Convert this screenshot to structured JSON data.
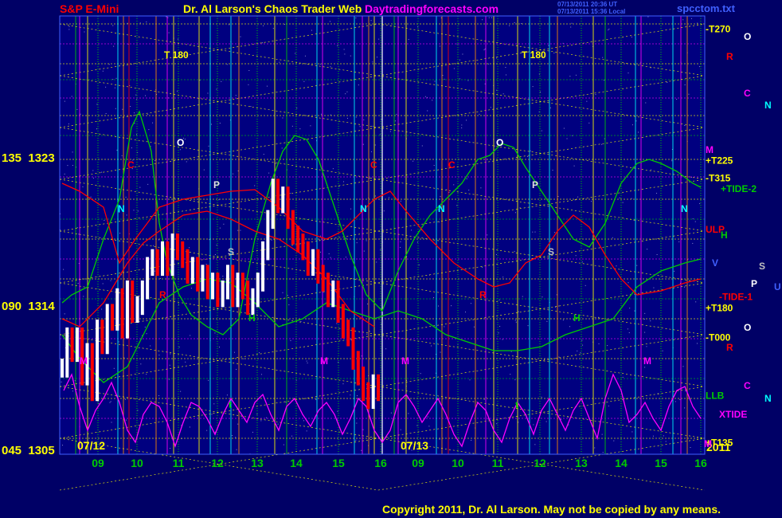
{
  "header": {
    "instrument": "S&P E-Mini",
    "title": "Dr. Al Larson's Chaos Trader Web",
    "site": "Daytradingforecasts.com",
    "timestamp_line1": "07/13/2011 20:36 UT",
    "timestamp_line2": "07/13/2011 15:36 Local",
    "file": "spcctom.txt"
  },
  "footer": {
    "copyright": "Copyright 2011, Dr. Al Larson. May not be copied by any means."
  },
  "colors": {
    "background": "#000066",
    "plot_background": "#000080",
    "hour_green": "#00cc00",
    "cyan": "#00ffff",
    "magenta": "#ff00ff",
    "yellow": "#ffff00",
    "red": "#ff0000",
    "white": "#ffffff",
    "orange": "#ff8c00"
  },
  "chart_data": {
    "type": "line",
    "title": "S&P E-Mini",
    "y_axis_labels": [
      {
        "label": "135  1323",
        "value": 1323
      },
      {
        "label": "090  1314",
        "value": 1314
      },
      {
        "label": "045  1305",
        "value": 1305
      }
    ],
    "ylim": [
      1305,
      1333
    ],
    "x_axis": {
      "unit": "hour",
      "day1_label": "07/12",
      "day2_label": "07/13",
      "year_label": "2011",
      "day1_hours": [
        "09",
        "10",
        "11",
        "12",
        "13",
        "14",
        "15",
        "16"
      ],
      "day2_hours": [
        "09",
        "10",
        "11",
        "12",
        "13",
        "14",
        "15",
        "16"
      ]
    },
    "price_bars_day1": [
      1310.5,
      1312.5,
      1311.5,
      1312.5,
      1310.0,
      1311.5,
      1309.0,
      1313.0,
      1312.0,
      1314.0,
      1313.5,
      1315.0,
      1313.0,
      1315.5,
      1314.0,
      1314.5,
      1315.5,
      1317.0,
      1317.5,
      1317.0,
      1318.0,
      1317.0,
      1318.5,
      1318.0,
      1317.5,
      1316.5,
      1317.0,
      1316.0,
      1316.5,
      1315.5,
      1316.0,
      1315.0,
      1315.5,
      1316.5,
      1315.0,
      1316.0,
      1315.5,
      1314.5,
      1315.0,
      1316.0,
      1318.0,
      1320.0,
      1322.0,
      1321.0,
      1321.5,
      1320.0,
      1319.0,
      1318.5,
      1318.0,
      1317.0,
      1317.5,
      1316.5,
      1316.0,
      1315.0,
      1315.5,
      1314.0,
      1313.0,
      1312.5,
      1311.0,
      1310.0,
      1309.0,
      1308.5,
      1309.5,
      1309.0
    ],
    "right_labels": [
      {
        "text": "-T270",
        "value": 1332.2
      },
      {
        "text": "+T225",
        "value": 1323.8
      },
      {
        "text": "-T315",
        "value": 1322.7
      },
      {
        "text": "+TIDE-2",
        "value": 1322.0
      },
      {
        "text": "ULP",
        "value": 1319.4
      },
      {
        "text": "-TIDE-1",
        "value": 1315.1
      },
      {
        "text": "+T180",
        "value": 1314.4
      },
      {
        "text": "-T000",
        "value": 1312.5
      },
      {
        "text": "LLB",
        "value": 1308.8
      },
      {
        "text": "XTIDE",
        "value": 1307.6
      },
      {
        "text": "+T135",
        "value": 1305.8
      }
    ],
    "planet_markers_right": [
      "O",
      "R",
      "C",
      "N",
      "M",
      "S",
      "P",
      "U",
      "V",
      "H",
      "O",
      "R",
      "C",
      "N",
      "M"
    ],
    "chart_letters": [
      "T 180",
      "T 180",
      "O",
      "O",
      "C",
      "C",
      "C",
      "N",
      "N",
      "N",
      "N",
      "P",
      "P",
      "S",
      "S",
      "H",
      "H",
      "M",
      "M",
      "M",
      "M",
      "R",
      "R",
      "t",
      "t"
    ],
    "series": [
      {
        "name": "TIDE-1",
        "color": "#ff0000"
      },
      {
        "name": "TIDE-2",
        "color": "#00cc00"
      },
      {
        "name": "XTIDE",
        "color": "#ff00ff"
      }
    ],
    "grid": true,
    "legend": "right"
  }
}
